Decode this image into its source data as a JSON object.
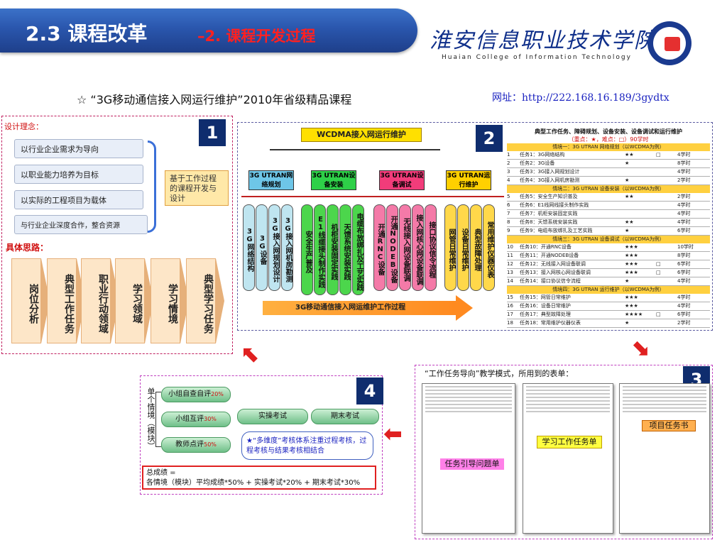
{
  "header": {
    "section": "2.3 课程改革",
    "subtitle": "–2. 课程开发过程",
    "college_name": "淮安信息职业技术学院",
    "college_en": "Huaian College of Information Technology"
  },
  "course": {
    "text": "☆ “3G移动通信接入网运行维护”2010年省级精品课程",
    "url": "网址：http://222.168.16.189/3gydtx"
  },
  "panel1": {
    "number": "1",
    "concept_label": "设计理念：",
    "concepts": [
      "以行业企业需求为导向",
      "以职业能力培养为目标",
      "以实际的工程项目为载体",
      "与行业企业深度合作，整合资源"
    ],
    "note": "基于工作过程的课程开发与设计",
    "approach_label": "具体思路：",
    "steps": [
      "岗位分析",
      "典型工作任务",
      "职业行动领域",
      "学习领域",
      "学习情境",
      "典型学习任务"
    ]
  },
  "panel2": {
    "number": "2",
    "top": "WCDMA接入网运行维护",
    "categories": [
      "3G UTRAN网络规划",
      "3G UTRAN设备安装",
      "3G UTRAN设备调试",
      "3G UTRAN运行维护"
    ],
    "columns": [
      "3G网络结构",
      "3G设备",
      "3G接入网规划设计",
      "3G接入网机房勘测",
      "安全生产普及",
      "E1线缆接头制作实践",
      "机柜安装固定实践",
      "天馈系统安装实践",
      "电缆布放绑扎及工艺实践",
      "开通RNC设备",
      "开通NODEB设备",
      "无线接入网设备联调",
      "接入网核心网设备联调",
      "接口协议信令流程",
      "网管日常维护",
      "设备日常维护",
      "典型故障处理",
      "常用维护仪器仪表"
    ],
    "flow": "3G移动通信接入网运维护工作过程",
    "table_title": "典型工作任务、障碍规划、设备安装、设备调试和运行维护",
    "table_sub": "（重点：★，难点：□）90学时",
    "sections": [
      "情境一：3G UTRAN 网络规划（以WCDMA为例）",
      "情境二：3G UTRAN 设备安装（以WCDMA为例）",
      "情境三：3G UTRAN 设备调试（以WCDMA为例）",
      "情境四：3G UTRAN 运行维护（以WCDMA为例）"
    ],
    "tasks": [
      [
        "1",
        "任务1：3G网络结构",
        "★★",
        "□",
        "4学时"
      ],
      [
        "2",
        "任务2：3G设备",
        "★",
        "",
        "8学时"
      ],
      [
        "3",
        "任务3：3G接入网规划设计",
        "",
        "",
        "4学时"
      ],
      [
        "4",
        "任务4：3G接入网机房勘测",
        "★",
        "",
        "2学时"
      ],
      [
        "5",
        "任务5：安全生产知识普及",
        "★★",
        "",
        "2学时"
      ],
      [
        "6",
        "任务6：E1线网线接头制作实践",
        "",
        "",
        "4学时"
      ],
      [
        "7",
        "任务7：机柜安装固定实践",
        "",
        "",
        "4学时"
      ],
      [
        "8",
        "任务8：天馈系统安装实践",
        "★★",
        "",
        "4学时"
      ],
      [
        "9",
        "任务9：电缆布放绑扎及工艺实践",
        "★",
        "",
        "6学时"
      ],
      [
        "10",
        "任务10：开通RNC设备",
        "★★★",
        "",
        "10学时"
      ],
      [
        "11",
        "任务11：开通NODEB设备",
        "★★★",
        "",
        "8学时"
      ],
      [
        "12",
        "任务12：无线接入网设备联调",
        "★★★",
        "□",
        "6学时"
      ],
      [
        "13",
        "任务13：接入网核心网设备联调",
        "★★★",
        "□",
        "6学时"
      ],
      [
        "14",
        "任务14：接口协议信令流程",
        "★",
        "",
        "4学时"
      ],
      [
        "15",
        "任务15：网管日常维护",
        "★★★",
        "",
        "4学时"
      ],
      [
        "16",
        "任务16：设备日常维护",
        "★★★",
        "",
        "4学时"
      ],
      [
        "17",
        "任务17：典型故障处理",
        "★★★★",
        "□",
        "6学时"
      ],
      [
        "18",
        "任务18：常用维护仪器仪表",
        "★",
        "",
        "2学时"
      ]
    ]
  },
  "panel3": {
    "number": "3",
    "caption": "“工作任务导向”教学模式，所用到的表单：",
    "forms": [
      "任务引导问题单",
      "学习工作任务单",
      "项目任务书"
    ]
  },
  "panel4": {
    "number": "4",
    "side_label": "单个情境（模块）",
    "evals": [
      {
        "label": "小组自查自评",
        "pct": "20%"
      },
      {
        "label": "小组互评",
        "pct": "30%"
      },
      {
        "label": "教师点评",
        "pct": "50%"
      }
    ],
    "exam1": "实操考试",
    "exam2": "期末考试",
    "note": "★“多维度”考核体系注重过程考核，过程考核与结果考核相结合",
    "total1": "总成绩 =",
    "total2": "各情境（模块）平均成绩*50% + 实操考试*20% + 期末考试*30%"
  },
  "colors": {
    "title_blue": "#2a56ad",
    "accent_red": "#e02020",
    "number_bg": "#0f2d6e"
  }
}
